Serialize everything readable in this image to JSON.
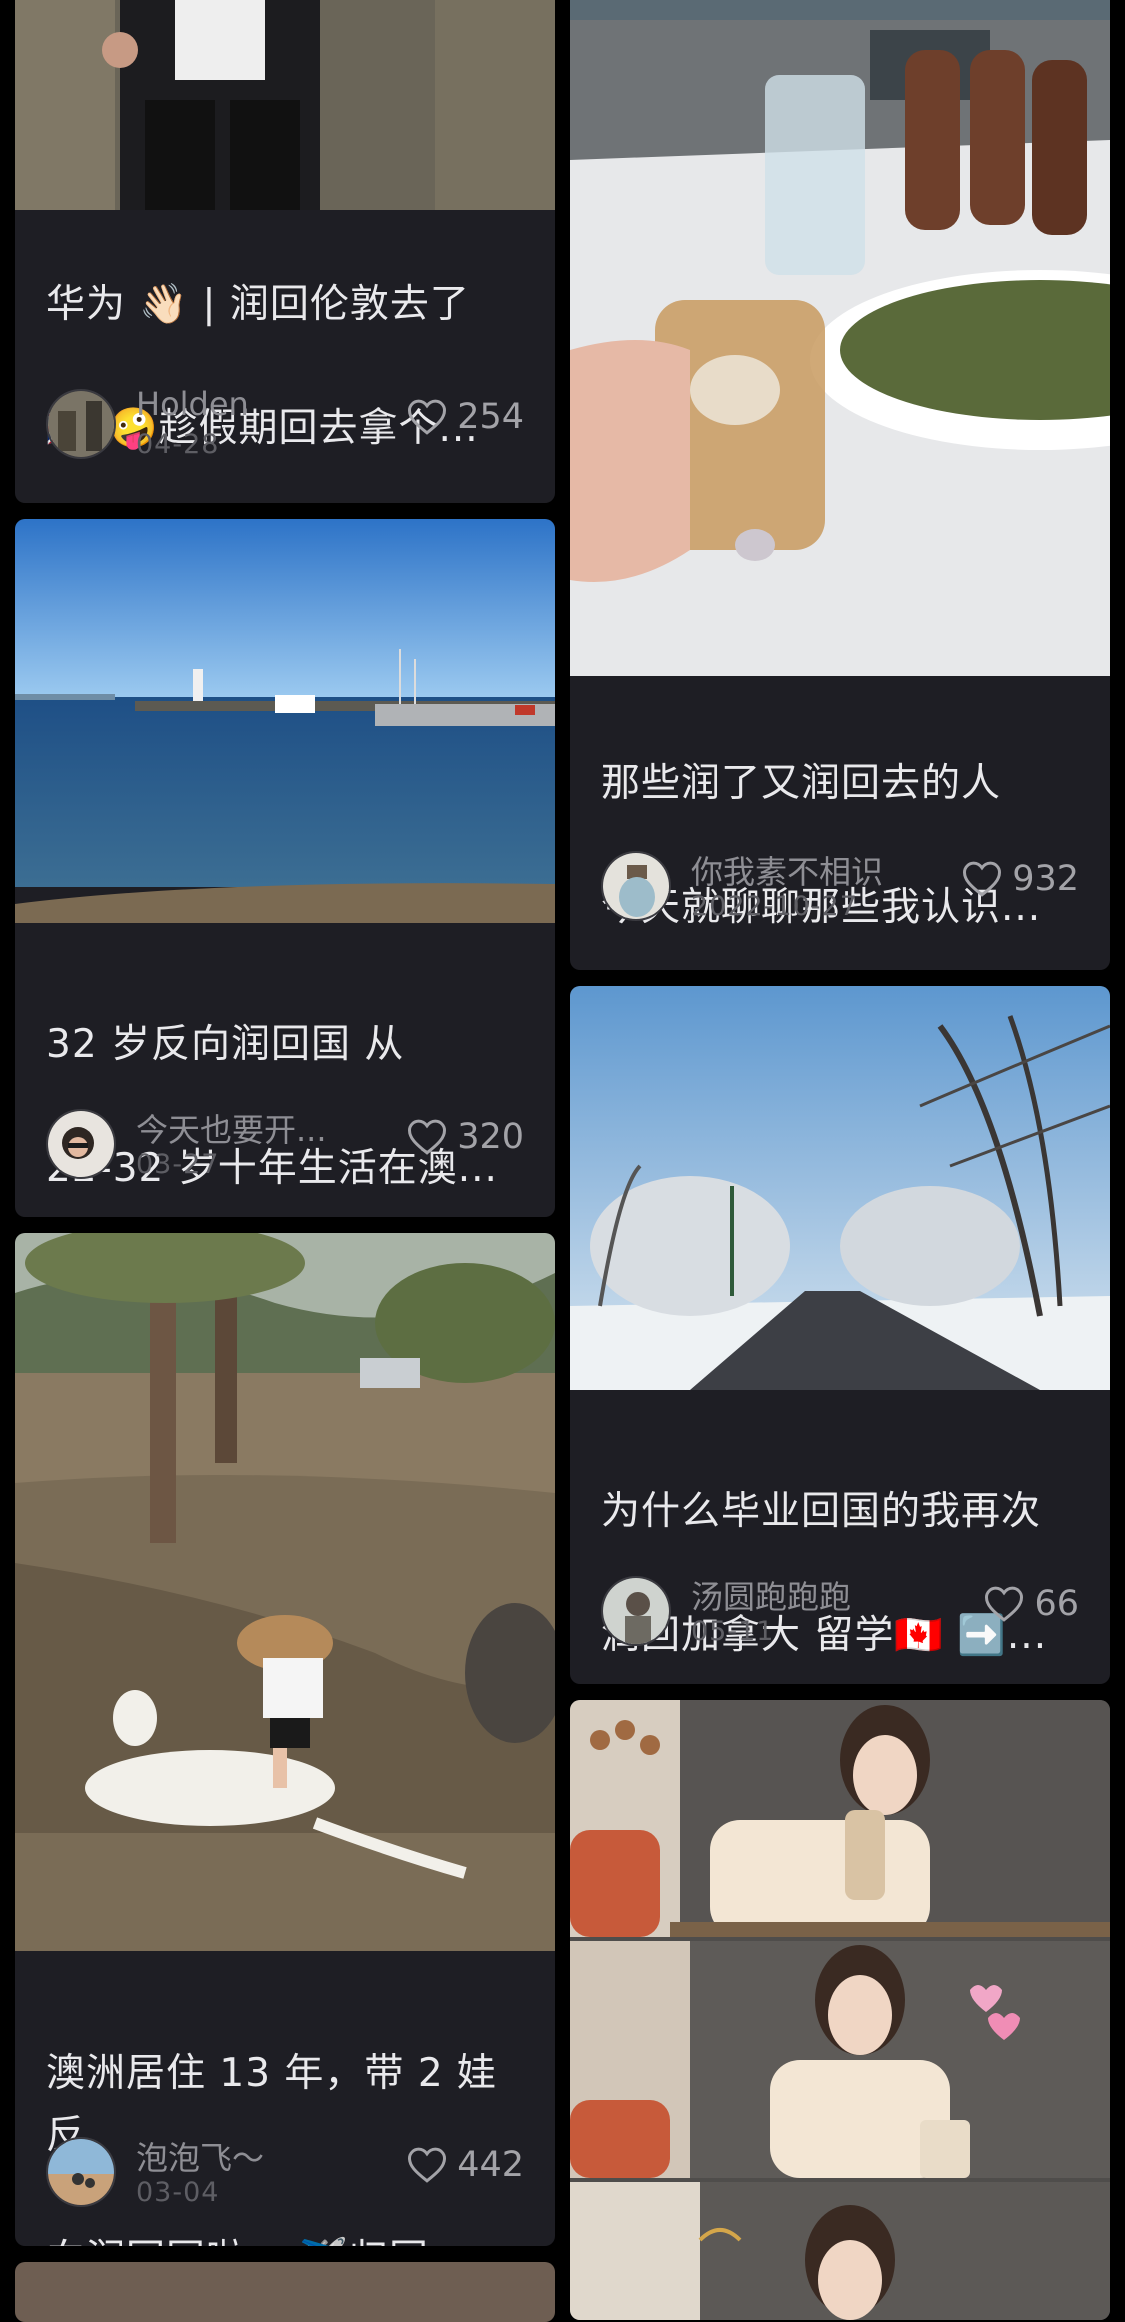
{
  "cards": [
    {
      "title_line1": "华为 👋🏻 | 润回伦敦去了",
      "title_line2": "🇬🇧 🤪趁假期回去拿个...",
      "author": "Holden",
      "date": "04-28",
      "likes": "254"
    },
    {
      "title_line1": "那些润了又润回去的人",
      "title_line2": "今天就聊聊那些我认识...",
      "author": "你我素不相识",
      "date": "2022-10-27",
      "likes": "932"
    },
    {
      "title_line1": "32 岁反向润回国 从",
      "title_line2": "22-32 岁十年生活在澳...",
      "author": "今天也要开...",
      "date": "03-27",
      "likes": "320"
    },
    {
      "title_line1": "为什么毕业回国的我再次",
      "title_line2": "润回加拿大 留学🇨🇦 ➡️...",
      "author": "汤圆跑跑跑",
      "date": "05-11",
      "likes": "66"
    },
    {
      "title_line1": "澳洲居住 13 年，带 2 娃反",
      "title_line2": "向润回国啦。 ✈️归国...",
      "author": "泡泡飞～",
      "date": "03-04",
      "likes": "442"
    }
  ],
  "colors": {
    "background": "#000000",
    "card": "#1e1e24",
    "title": "#e9e9ec",
    "meta": "#8e8e94"
  },
  "icons": {
    "like": "heart-outline-icon"
  }
}
